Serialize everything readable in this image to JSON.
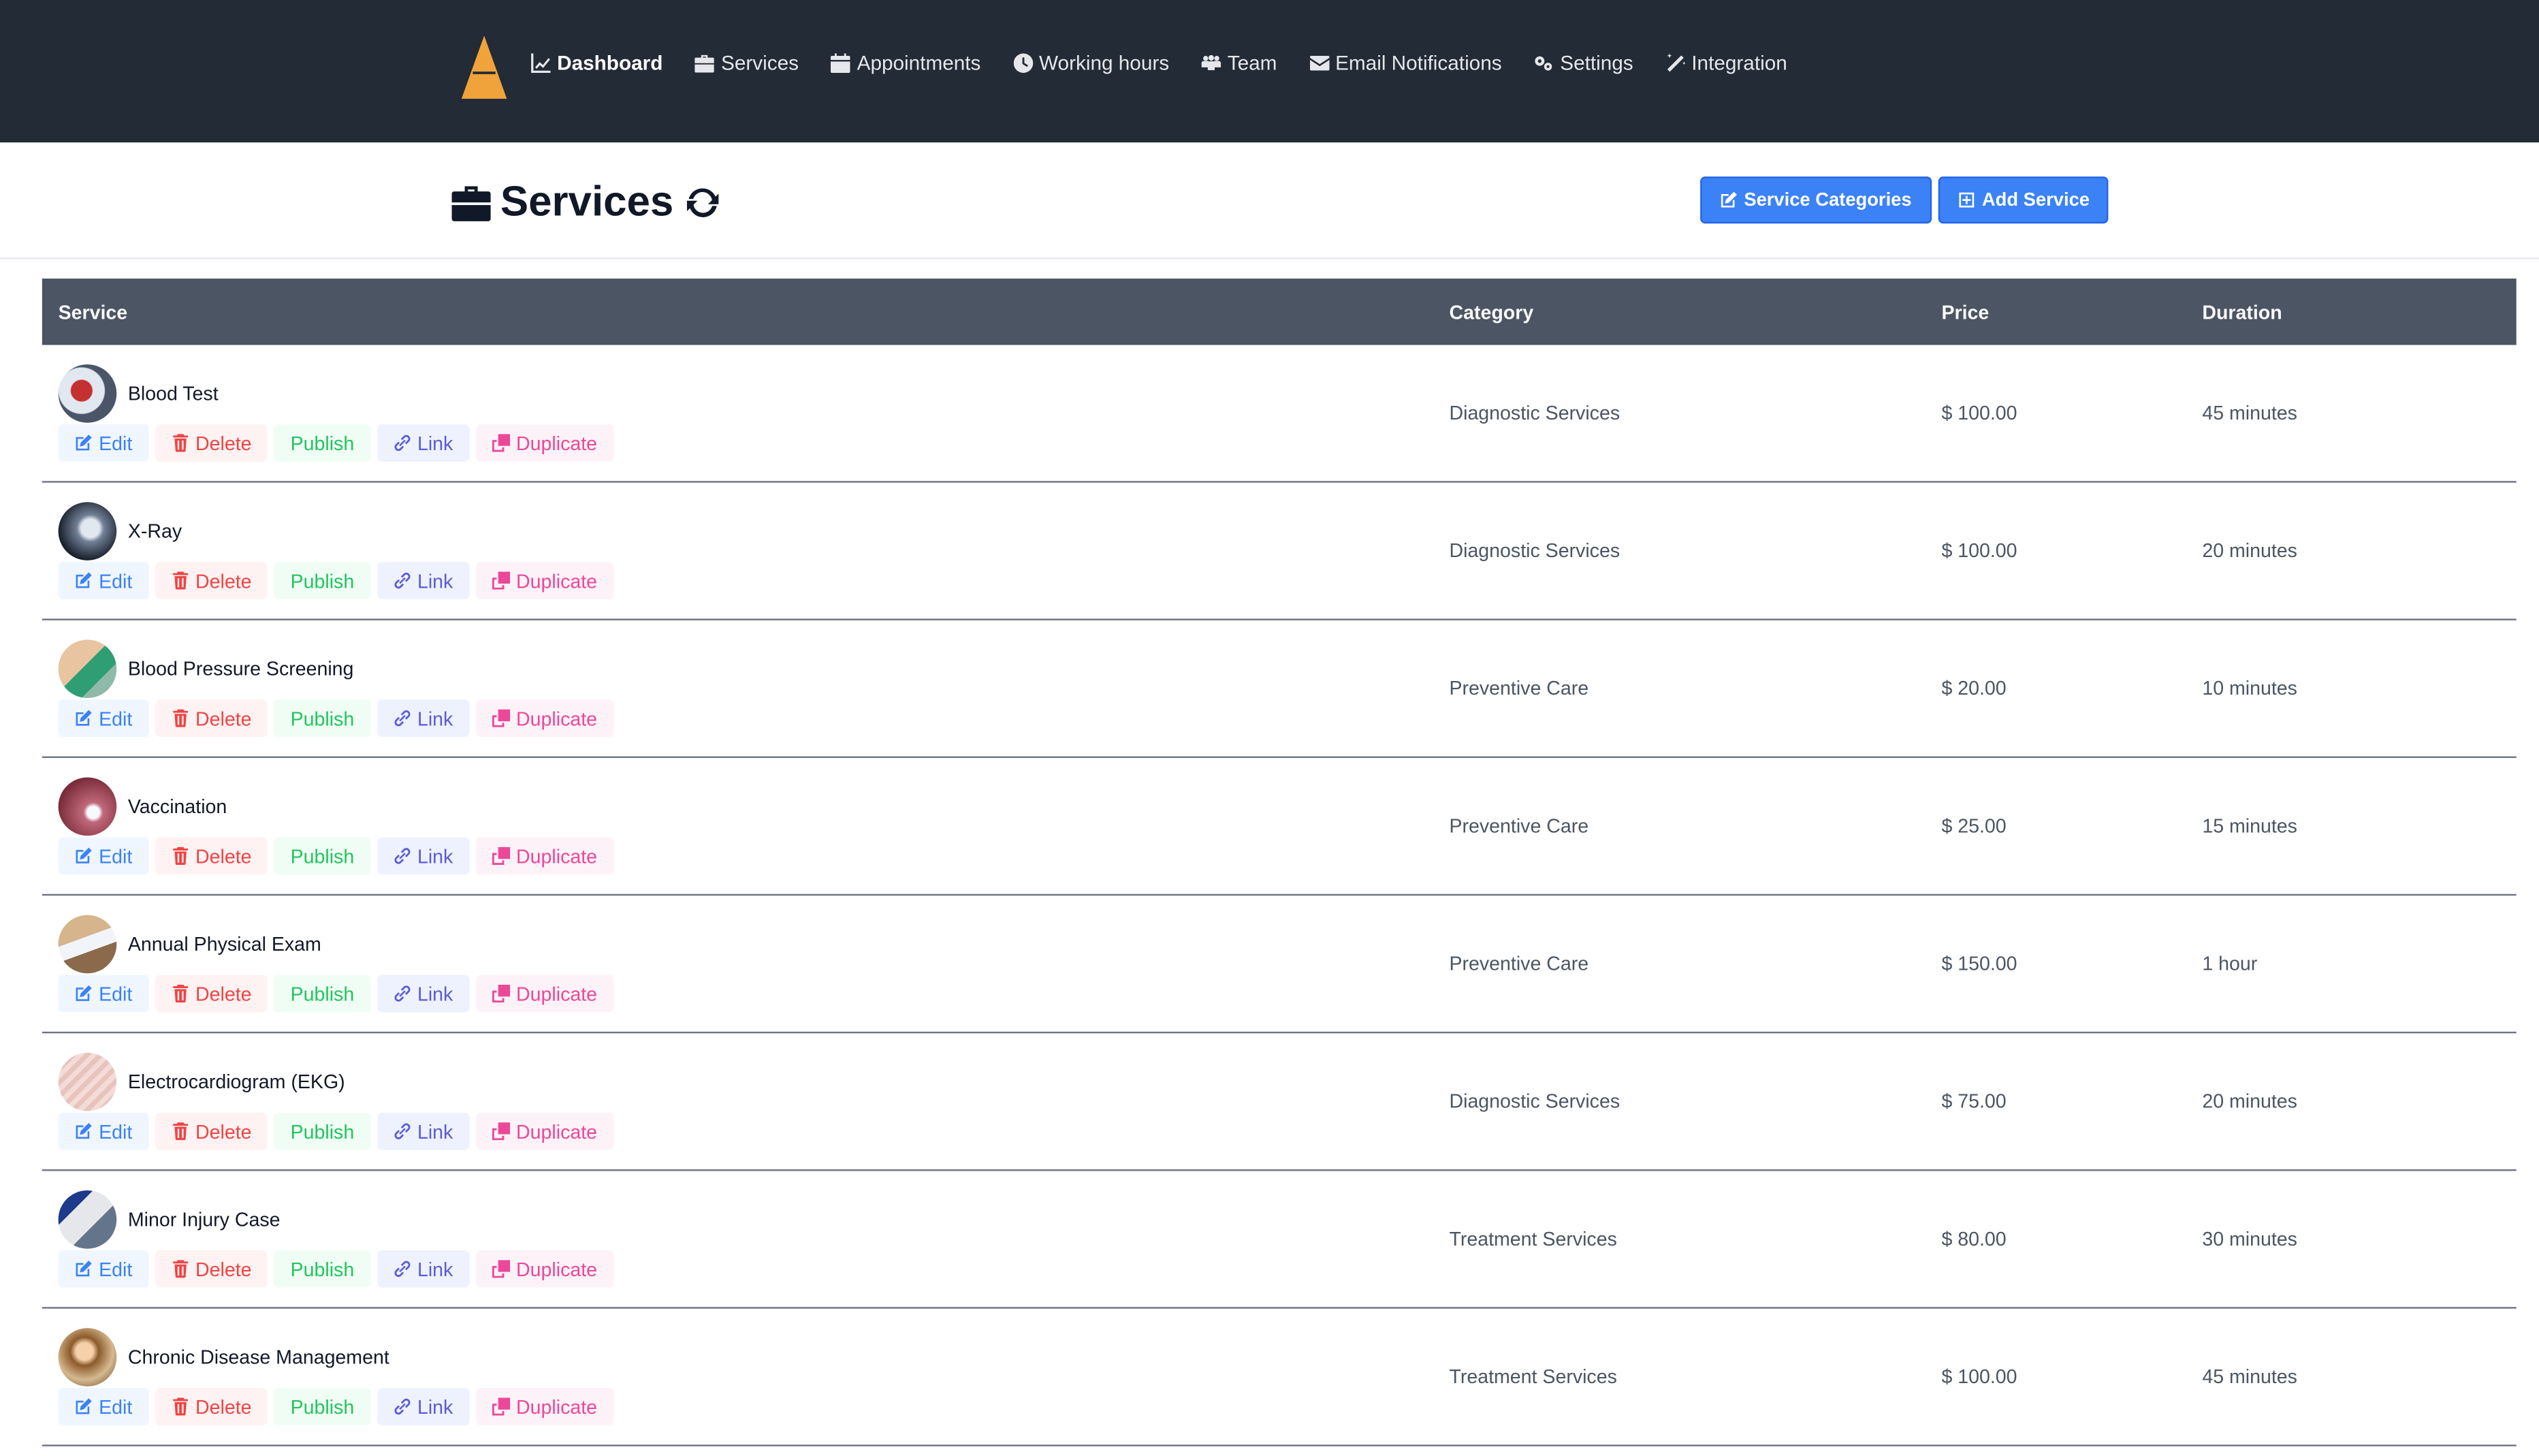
{
  "nav": {
    "items": [
      {
        "label": "Dashboard",
        "icon": "chart-line-icon",
        "active": true
      },
      {
        "label": "Services",
        "icon": "briefcase-icon"
      },
      {
        "label": "Appointments",
        "icon": "calendar-icon"
      },
      {
        "label": "Working hours",
        "icon": "clock-icon"
      },
      {
        "label": "Team",
        "icon": "users-icon"
      },
      {
        "label": "Email Notifications",
        "icon": "envelope-icon"
      },
      {
        "label": "Settings",
        "icon": "gears-icon"
      },
      {
        "label": "Integration",
        "icon": "magic-wand-icon"
      }
    ]
  },
  "page": {
    "title": "Services",
    "service_categories_label": "Service Categories",
    "add_service_label": "Add Service"
  },
  "table": {
    "headers": {
      "service": "Service",
      "category": "Category",
      "price": "Price",
      "duration": "Duration"
    },
    "actions": {
      "edit": "Edit",
      "delete": "Delete",
      "publish": "Publish",
      "link": "Link",
      "duplicate": "Duplicate"
    },
    "rows": [
      {
        "name": "Blood Test",
        "category": "Diagnostic Services",
        "price": "$ 100.00",
        "duration": "45 minutes"
      },
      {
        "name": "X-Ray",
        "category": "Diagnostic Services",
        "price": "$ 100.00",
        "duration": "20 minutes"
      },
      {
        "name": "Blood Pressure Screening",
        "category": "Preventive Care",
        "price": "$ 20.00",
        "duration": "10 minutes"
      },
      {
        "name": "Vaccination",
        "category": "Preventive Care",
        "price": "$ 25.00",
        "duration": "15 minutes"
      },
      {
        "name": "Annual Physical Exam",
        "category": "Preventive Care",
        "price": "$ 150.00",
        "duration": "1 hour"
      },
      {
        "name": "Electrocardiogram (EKG)",
        "category": "Diagnostic Services",
        "price": "$ 75.00",
        "duration": "20 minutes"
      },
      {
        "name": "Minor Injury Case",
        "category": "Treatment Services",
        "price": "$ 80.00",
        "duration": "30 minutes"
      },
      {
        "name": "Chronic Disease Management",
        "category": "Treatment Services",
        "price": "$ 100.00",
        "duration": "45 minutes"
      }
    ]
  },
  "colors": {
    "nav_bg": "#222b36",
    "primary": "#3b82f6",
    "table_header_bg": "#4b5563",
    "logo": "#f0a23b"
  }
}
